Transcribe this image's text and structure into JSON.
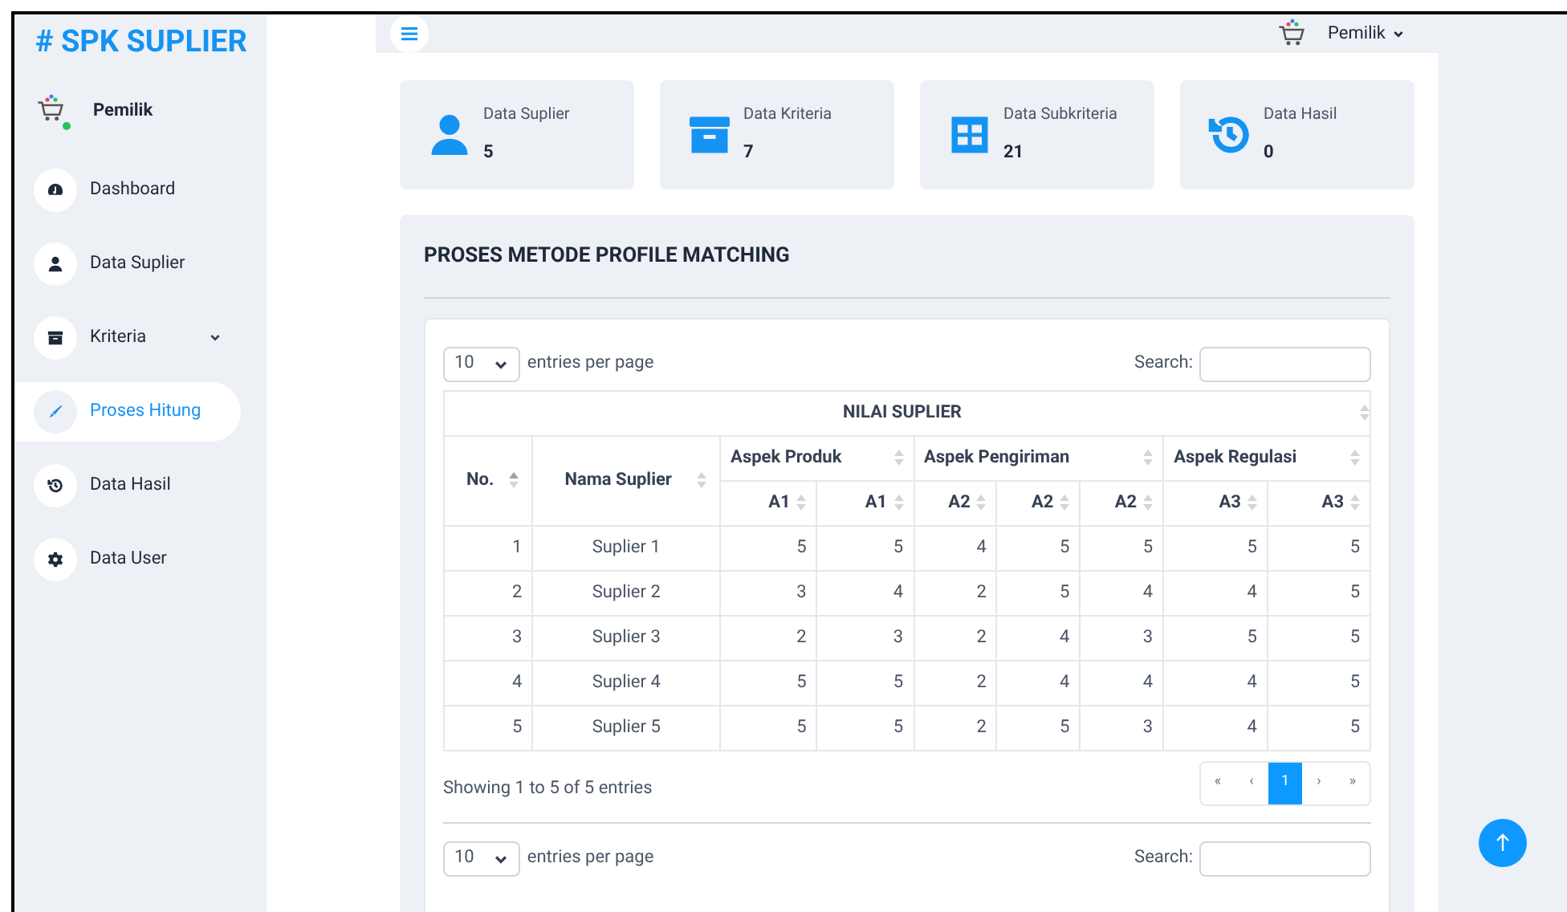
{
  "brand": "# SPK SUPLIER",
  "user": {
    "name": "Pemilik",
    "online": true
  },
  "sidebar": {
    "items": [
      {
        "label": "Dashboard",
        "kind": "gauge",
        "selected": false
      },
      {
        "label": "Data Suplier",
        "kind": "user",
        "selected": false
      },
      {
        "label": "Kriteria",
        "kind": "archive",
        "selected": false,
        "expandable": true
      },
      {
        "label": "Proses Hitung",
        "kind": "pen",
        "selected": true
      },
      {
        "label": "Data Hasil",
        "kind": "history",
        "selected": false
      },
      {
        "label": "Data User",
        "kind": "gear",
        "selected": false
      }
    ]
  },
  "header": {
    "user_name": "Pemilik"
  },
  "stats": [
    {
      "label": "Data Suplier",
      "value": "5",
      "kind": "user"
    },
    {
      "label": "Data Kriteria",
      "value": "7",
      "kind": "archive"
    },
    {
      "label": "Data Subkriteria",
      "value": "21",
      "kind": "grid"
    },
    {
      "label": "Data Hasil",
      "value": "0",
      "kind": "history"
    }
  ],
  "panel": {
    "title": "PROSES METODE PROFILE MATCHING",
    "table_block": {
      "entries": "10",
      "entries_label": "entries per page",
      "search_label": "Search:",
      "group_heading": "NILAI SUPLIER",
      "columns": [
        "No.",
        "Nama Suplier"
      ],
      "aspects": [
        {
          "name": "Aspek Produk",
          "subs": [
            "A1",
            "A1"
          ]
        },
        {
          "name": "Aspek Pengiriman",
          "subs": [
            "A2",
            "A2",
            "A2"
          ]
        },
        {
          "name": "Aspek Regulasi",
          "subs": [
            "A3",
            "A3"
          ]
        }
      ],
      "rows": [
        [
          "1",
          "Suplier 1",
          "5",
          "5",
          "4",
          "5",
          "5",
          "5",
          "5"
        ],
        [
          "2",
          "Suplier 2",
          "3",
          "4",
          "2",
          "5",
          "4",
          "4",
          "5"
        ],
        [
          "3",
          "Suplier 3",
          "2",
          "3",
          "2",
          "4",
          "3",
          "5",
          "5"
        ],
        [
          "4",
          "Suplier 4",
          "5",
          "5",
          "2",
          "4",
          "4",
          "4",
          "5"
        ],
        [
          "5",
          "Suplier 5",
          "5",
          "5",
          "2",
          "5",
          "3",
          "4",
          "5"
        ]
      ],
      "info": "Showing 1 to 5 of 5 entries",
      "pagination": [
        {
          "label": "«",
          "selected": false
        },
        {
          "label": "‹",
          "selected": false
        },
        {
          "label": "1",
          "selected": true
        },
        {
          "label": "›",
          "selected": false
        },
        {
          "label": "»",
          "selected": false
        }
      ]
    },
    "second_block": {
      "entries": "10",
      "entries_label": "entries per page",
      "search_label": "Search:"
    }
  }
}
